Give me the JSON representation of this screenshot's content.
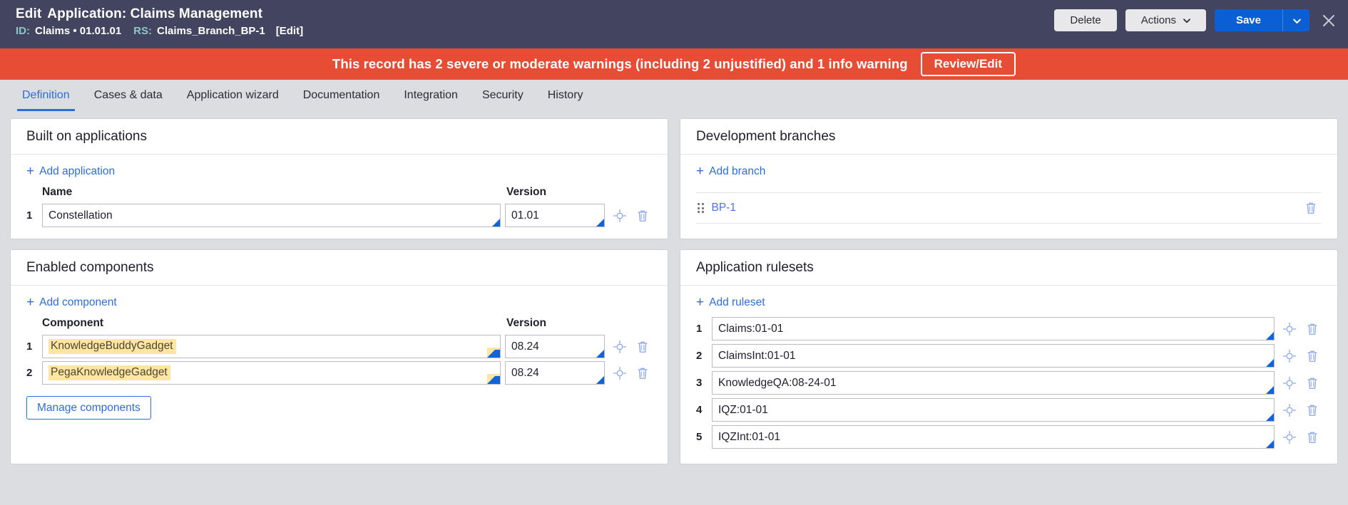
{
  "header": {
    "edit_label": "Edit",
    "title": "Application: Claims Management",
    "id_label": "ID:",
    "id_value": "Claims • 01.01.01",
    "rs_label": "RS:",
    "rs_value": "Claims_Branch_BP-1",
    "edit_link": "[Edit]",
    "delete_label": "Delete",
    "actions_label": "Actions",
    "save_label": "Save",
    "bg_color": "#434560",
    "primary_color": "#0b5fd4"
  },
  "warning": {
    "message": "This record has 2 severe or moderate warnings (including 2 unjustified) and 1 info warning",
    "button_label": "Review/Edit",
    "bg_color": "#e74c34"
  },
  "tabs": [
    {
      "label": "Definition",
      "active": true
    },
    {
      "label": "Cases & data",
      "active": false
    },
    {
      "label": "Application wizard",
      "active": false
    },
    {
      "label": "Documentation",
      "active": false
    },
    {
      "label": "Integration",
      "active": false
    },
    {
      "label": "Security",
      "active": false
    },
    {
      "label": "History",
      "active": false
    }
  ],
  "built_on": {
    "title": "Built on applications",
    "add_label": "Add application",
    "col_name": "Name",
    "col_version": "Version",
    "rows": [
      {
        "num": "1",
        "name": "Constellation",
        "version": "01.01"
      }
    ]
  },
  "branches": {
    "title": "Development branches",
    "add_label": "Add branch",
    "rows": [
      {
        "name": "BP-1"
      }
    ]
  },
  "components": {
    "title": "Enabled components",
    "add_label": "Add component",
    "col_component": "Component",
    "col_version": "Version",
    "manage_label": "Manage components",
    "rows": [
      {
        "num": "1",
        "name": "KnowledgeBuddyGadget",
        "version": "08.24"
      },
      {
        "num": "2",
        "name": "PegaKnowledgeGadget",
        "version": "08.24"
      }
    ]
  },
  "rulesets": {
    "title": "Application rulesets",
    "add_label": "Add ruleset",
    "rows": [
      {
        "num": "1",
        "name": "Claims:01-01"
      },
      {
        "num": "2",
        "name": "ClaimsInt:01-01"
      },
      {
        "num": "3",
        "name": "KnowledgeQA:08-24-01"
      },
      {
        "num": "4",
        "name": "IQZ:01-01"
      },
      {
        "num": "5",
        "name": "IQZInt:01-01"
      }
    ]
  }
}
